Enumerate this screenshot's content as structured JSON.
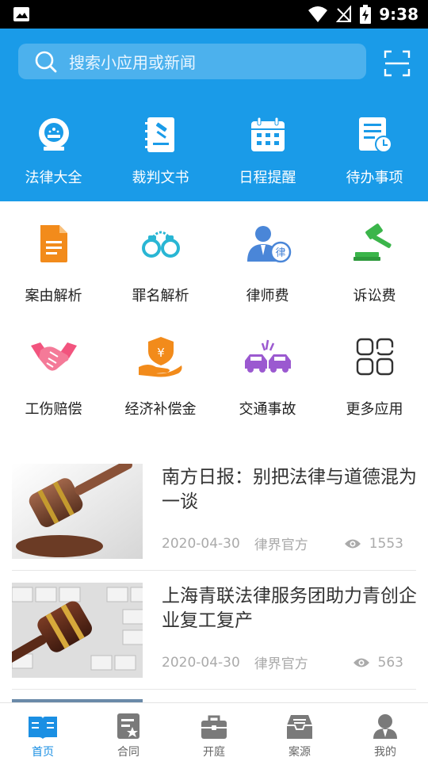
{
  "status_bar": {
    "time": "9:38"
  },
  "search": {
    "placeholder": "搜索小应用或新闻"
  },
  "top_tools": [
    {
      "label": "法律大全",
      "icon": "law-emblem-icon"
    },
    {
      "label": "裁判文书",
      "icon": "judgment-document-icon"
    },
    {
      "label": "日程提醒",
      "icon": "calendar-icon"
    },
    {
      "label": "待办事项",
      "icon": "todo-list-icon"
    }
  ],
  "apps_row1": [
    {
      "label": "案由解析",
      "icon": "document-icon"
    },
    {
      "label": "罪名解析",
      "icon": "handcuffs-icon"
    },
    {
      "label": "律师费",
      "icon": "lawyer-icon"
    },
    {
      "label": "诉讼费",
      "icon": "gavel-icon"
    }
  ],
  "apps_row2": [
    {
      "label": "工伤赔偿",
      "icon": "handshake-icon"
    },
    {
      "label": "经济补偿金",
      "icon": "compensation-hand-icon"
    },
    {
      "label": "交通事故",
      "icon": "car-crash-icon"
    },
    {
      "label": "更多应用",
      "icon": "more-apps-icon"
    }
  ],
  "news": [
    {
      "title": "南方日报：别把法律与道德混为一谈",
      "date": "2020-04-30",
      "source": "律界官方",
      "views": "1553"
    },
    {
      "title": "上海青联法律服务团助力青创企业复工复产",
      "date": "2020-04-30",
      "source": "律界官方",
      "views": "563"
    }
  ],
  "bottom_nav": [
    {
      "label": "首页",
      "icon": "home-book-icon",
      "active": true
    },
    {
      "label": "合同",
      "icon": "contract-icon",
      "active": false
    },
    {
      "label": "开庭",
      "icon": "briefcase-icon",
      "active": false
    },
    {
      "label": "案源",
      "icon": "inbox-icon",
      "active": false
    },
    {
      "label": "我的",
      "icon": "profile-icon",
      "active": false
    }
  ],
  "colors": {
    "header_blue": "#1a9be8",
    "active_nav": "#1a8fe3"
  }
}
